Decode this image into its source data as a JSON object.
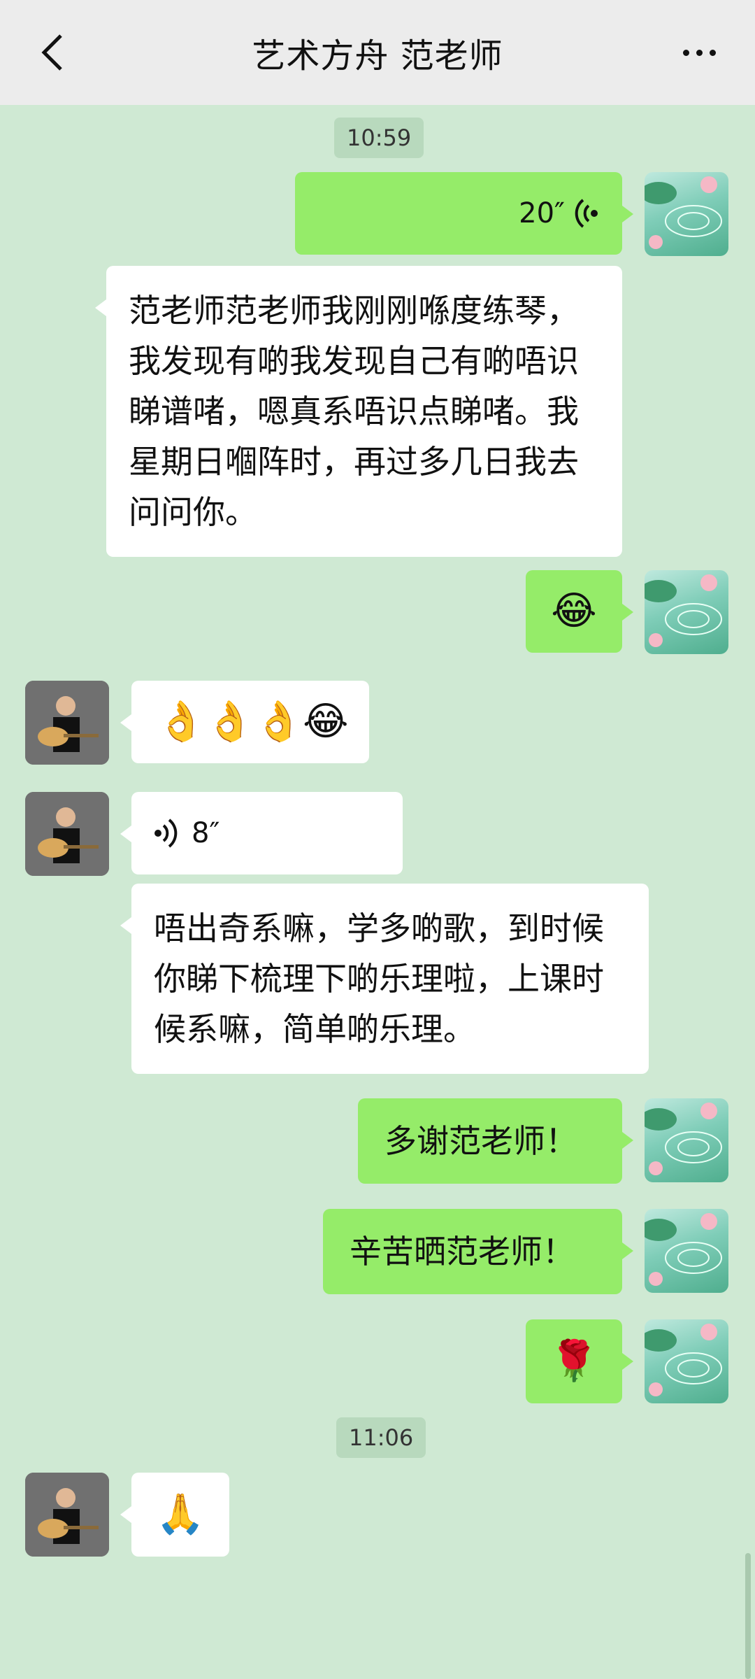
{
  "header": {
    "title": "艺术方舟  范老师"
  },
  "timestamps": [
    "10:59",
    "11:06"
  ],
  "messages": [
    {
      "from": "self",
      "type": "voice",
      "duration": "20″"
    },
    {
      "from": "teacher",
      "type": "text",
      "text": "范老师范老师我刚刚喺度练琴，我发现有啲我发现自己有啲唔识睇谱啫，嗯真系唔识点睇啫。我星期日嗰阵时，再过多几日我去问问你。"
    },
    {
      "from": "self",
      "type": "emoji",
      "text": "😂"
    },
    {
      "from": "teacher",
      "type": "emoji",
      "text": "👌👌👌😂"
    },
    {
      "from": "teacher",
      "type": "voice",
      "duration": "8″"
    },
    {
      "from": "teacher",
      "type": "text",
      "text": "唔出奇系嘛，学多啲歌，到时候你睇下梳理下啲乐理啦，上课时候系嘛，简单啲乐理。"
    },
    {
      "from": "self",
      "type": "text",
      "text": "多谢范老师！"
    },
    {
      "from": "self",
      "type": "text",
      "text": "辛苦晒范老师！"
    },
    {
      "from": "self",
      "type": "emoji",
      "text": "🌹"
    },
    {
      "from": "teacher",
      "type": "emoji",
      "text": "🙏"
    }
  ],
  "icons": {
    "back": "back-chevron-icon",
    "more": "more-dots-icon",
    "voice": "voice-wave-icon"
  },
  "colors": {
    "outgoing": "#95ec69",
    "incoming": "#ffffff",
    "background": "#cfe9d3"
  }
}
